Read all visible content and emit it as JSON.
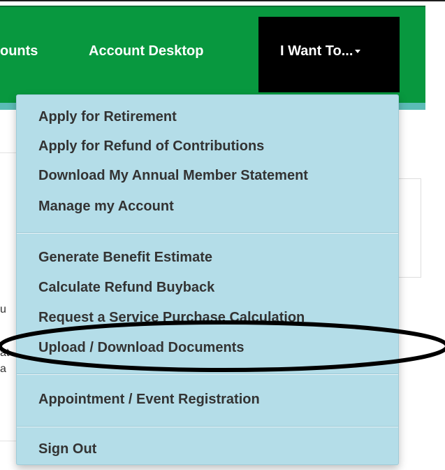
{
  "nav": {
    "items": [
      {
        "label": "ounts"
      },
      {
        "label": "Account Desktop"
      }
    ],
    "active": {
      "label": "I Want To...",
      "icon": "caret-down-icon"
    }
  },
  "background_text": {
    "line1": "u",
    "line2": "at",
    "line3": "a"
  },
  "menu": {
    "group1": [
      "Apply for Retirement",
      "Apply for Refund of Contributions",
      "Download My Annual Member Statement",
      "Manage my Account"
    ],
    "group2": [
      "Generate Benefit Estimate",
      "Calculate Refund Buyback",
      "Request a Service Purchase Calculation",
      "Upload / Download Documents"
    ],
    "group3": [
      "Appointment / Event Registration"
    ],
    "group4": [
      "Sign Out"
    ]
  },
  "colors": {
    "navbar": "#08983f",
    "teal_strip": "#5bbcb6",
    "active_bg": "#000000",
    "dropdown_bg": "#b4dde8",
    "annotation": "#000000"
  }
}
